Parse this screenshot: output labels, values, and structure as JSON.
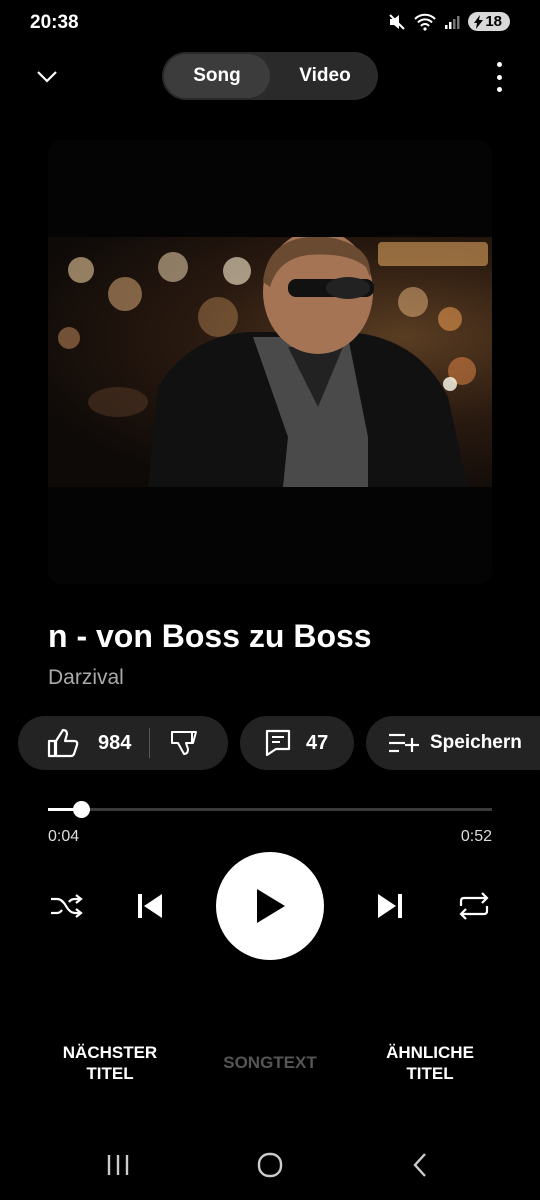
{
  "status_bar": {
    "time": "20:38",
    "battery": "18",
    "icons": [
      "mute-icon",
      "wifi-icon",
      "signal-icon",
      "charging-icon"
    ]
  },
  "header": {
    "tabs": [
      {
        "label": "Song",
        "active": true
      },
      {
        "label": "Video",
        "active": false
      }
    ]
  },
  "track": {
    "title": "n - von Boss zu Boss",
    "artist": "Darzival"
  },
  "actions": {
    "likes": "984",
    "comments": "47",
    "save_label": "Speichern"
  },
  "progress": {
    "current": "0:04",
    "total": "0:52",
    "fraction": 0.075
  },
  "bottom_tabs": {
    "next": "NÄCHSTER\nTITEL",
    "lyrics": "SONGTEXT",
    "related": "ÄHNLICHE\nTITEL"
  },
  "colors": {
    "background": "#000000",
    "pill": "#232323",
    "accent": "#ffffff",
    "dim_text": "#555555"
  }
}
